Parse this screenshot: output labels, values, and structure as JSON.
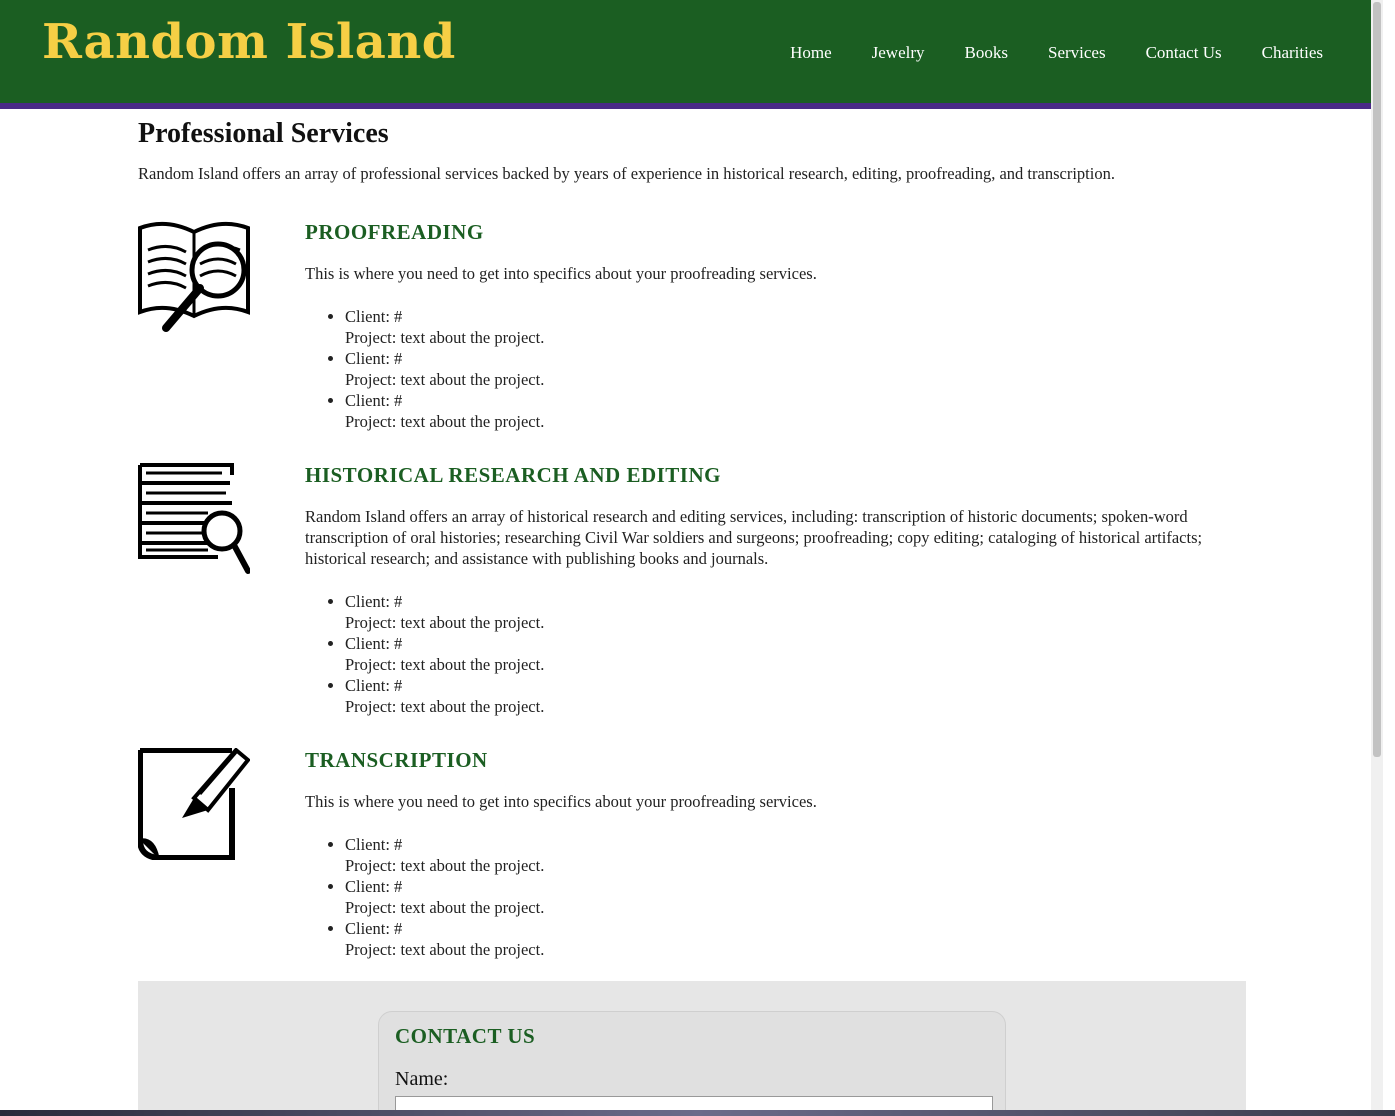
{
  "header": {
    "logo": "Random Island",
    "nav": [
      "Home",
      "Jewelry",
      "Books",
      "Services",
      "Contact Us",
      "Charities"
    ]
  },
  "main": {
    "title": "Professional Services",
    "intro": "Random Island offers an array of professional services backed by years of experience in historical research, editing, proofreading, and transcription.",
    "services": [
      {
        "icon": "book-magnifier-icon",
        "heading": "PROOFREADING",
        "description": "This is where you need to get into specifics about your proofreading services.",
        "items": [
          {
            "client": "Client: #",
            "project": "Project: text about the project."
          },
          {
            "client": "Client: #",
            "project": "Project: text about the project."
          },
          {
            "client": "Client: #",
            "project": "Project: text about the project."
          }
        ]
      },
      {
        "icon": "document-search-icon",
        "heading": "HISTORICAL RESEARCH AND EDITING",
        "description": "Random Island offers an array of historical research and editing services, including: transcription of historic documents; spoken-word transcription of oral histories; researching Civil War soldiers and surgeons; proofreading; copy editing; cataloging of historical artifacts; historical research; and assistance with publishing books and journals.",
        "items": [
          {
            "client": "Client: #",
            "project": "Project: text about the project."
          },
          {
            "client": "Client: #",
            "project": "Project: text about the project."
          },
          {
            "client": "Client: #",
            "project": "Project: text about the project."
          }
        ]
      },
      {
        "icon": "pen-paper-icon",
        "heading": "TRANSCRIPTION",
        "description": "This is where you need to get into specifics about your proofreading services.",
        "items": [
          {
            "client": "Client: #",
            "project": "Project: text about the project."
          },
          {
            "client": "Client: #",
            "project": "Project: text about the project."
          },
          {
            "client": "Client: #",
            "project": "Project: text about the project."
          }
        ]
      }
    ]
  },
  "contact": {
    "heading": "CONTACT US",
    "name_label": "Name:"
  },
  "colors": {
    "header_bg": "#1b5e22",
    "logo": "#f6cf45",
    "accent_border": "#4a2a86",
    "heading_green": "#1b5e22"
  }
}
